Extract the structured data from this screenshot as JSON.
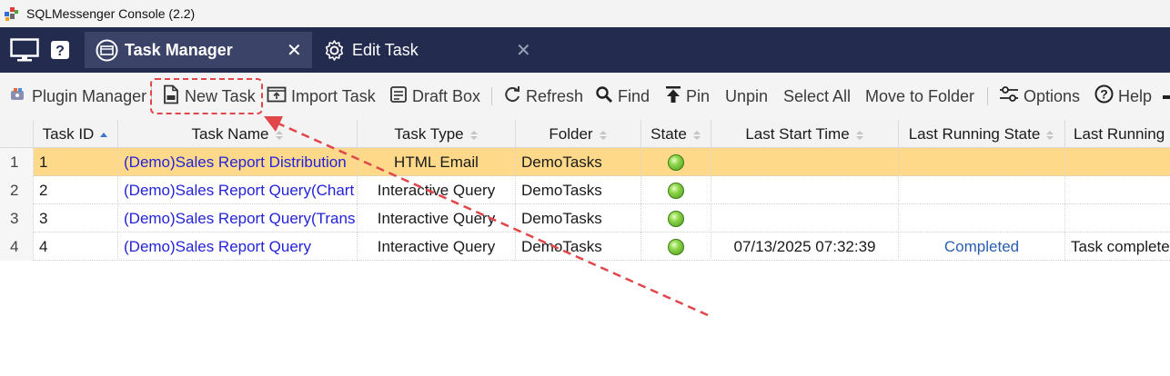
{
  "window": {
    "title": "SQLMessenger Console (2.2)"
  },
  "tabs": [
    {
      "label": "Task Manager",
      "icon": "task-manager-icon",
      "active": true
    },
    {
      "label": "Edit Task",
      "icon": "gear-icon",
      "active": false
    }
  ],
  "tabbar_icons": [
    "monitor-icon",
    "help-icon"
  ],
  "toolbar": {
    "plugin_manager": "Plugin Manager",
    "new_task": "New Task",
    "import_task": "Import Task",
    "draft_box": "Draft Box",
    "refresh": "Refresh",
    "find": "Find",
    "pin": "Pin",
    "unpin": "Unpin",
    "select_all": "Select All",
    "move_to_folder": "Move to Folder",
    "options": "Options",
    "help": "Help"
  },
  "table": {
    "columns": {
      "task_id": "Task ID",
      "task_name": "Task Name",
      "task_type": "Task Type",
      "folder": "Folder",
      "state": "State",
      "last_start_time": "Last Start Time",
      "last_running_state": "Last Running State",
      "last_running": "Last Running"
    },
    "rows": [
      {
        "num": "1",
        "task_id": "1",
        "task_name": "(Demo)Sales Report Distribution",
        "task_type": "HTML Email",
        "folder": "DemoTasks",
        "state": "green",
        "last_start_time": "",
        "last_running_state": "",
        "last_running": "",
        "selected": true
      },
      {
        "num": "2",
        "task_id": "2",
        "task_name": "(Demo)Sales Report Query(Chart",
        "task_type": "Interactive Query",
        "folder": "DemoTasks",
        "state": "green",
        "last_start_time": "",
        "last_running_state": "",
        "last_running": "",
        "selected": false
      },
      {
        "num": "3",
        "task_id": "3",
        "task_name": "(Demo)Sales Report Query(Trans",
        "task_type": "Interactive Query",
        "folder": "DemoTasks",
        "state": "green",
        "last_start_time": "",
        "last_running_state": "",
        "last_running": "",
        "selected": false
      },
      {
        "num": "4",
        "task_id": "4",
        "task_name": "(Demo)Sales Report Query",
        "task_type": "Interactive Query",
        "folder": "DemoTasks",
        "state": "green",
        "last_start_time": "07/13/2025 07:32:39",
        "last_running_state": "Completed",
        "last_running": "Task complete",
        "selected": false
      }
    ]
  },
  "colors": {
    "tabbar": "#232b4e",
    "active_tab": "#3b4468",
    "selected_row": "#ffd98a",
    "link": "#2323d8",
    "annotation": "#e0464a"
  }
}
